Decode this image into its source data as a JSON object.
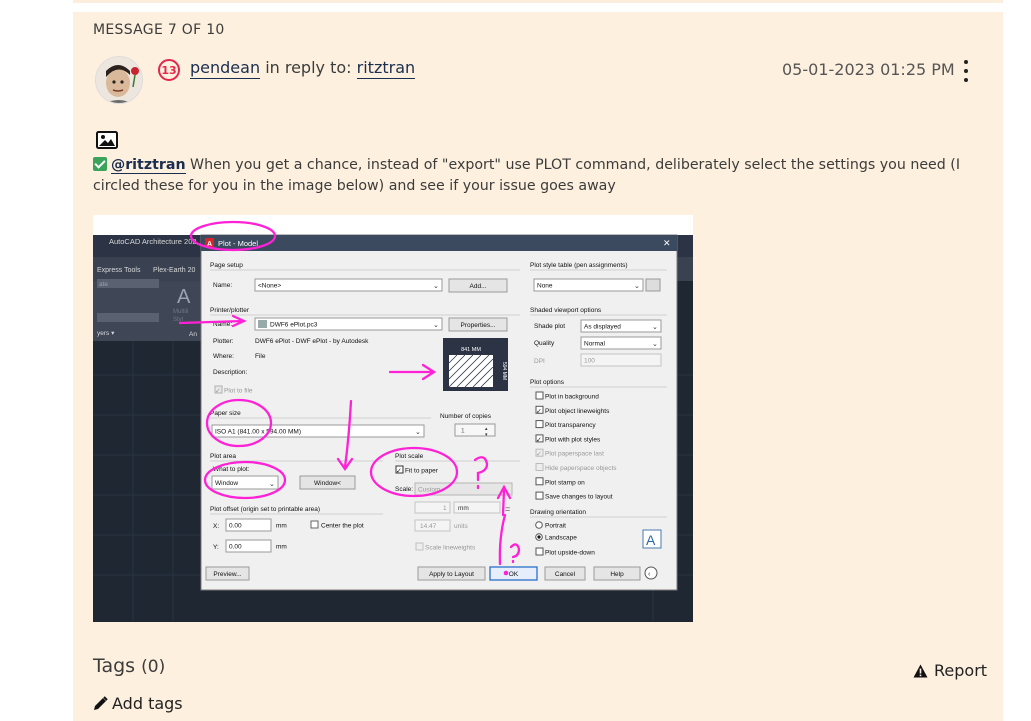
{
  "message": {
    "counter": "MESSAGE 7 OF 10",
    "rank": "13",
    "author": "pendean",
    "reply_text": "in reply to:",
    "reply_to": "ritztran",
    "date": "05-01-2023 01:25 PM",
    "mention": "@ritztran",
    "body": " When you get a chance, instead of \"export\" use PLOT command, deliberately select the settings you need (I circled these for you in the image below) and see if your issue goes away"
  },
  "dialog": {
    "app_title": "AutoCAD Architecture 202",
    "title": "Plot - Model",
    "ribbon_tab1": "Express Tools",
    "ribbon_tab2": "Plex-Earth 20",
    "ribbon_text1": "ate",
    "ribbon_text2": "yers ▾",
    "ribbon_text3": "Multili",
    "ribbon_text4": "Styl",
    "ribbon_text5": "An",
    "page_setup": {
      "label": "Page setup",
      "name_label": "Name:",
      "name_value": "<None>",
      "add_button": "Add..."
    },
    "printer": {
      "label": "Printer/plotter",
      "name_label": "Name:",
      "name_value": "DWF6 ePlot.pc3",
      "properties_button": "Properties...",
      "plotter_label": "Plotter:",
      "plotter_value": "DWF6 ePlot - DWF ePlot - by Autodesk",
      "where_label": "Where:",
      "where_value": "File",
      "description_label": "Description:",
      "plot_to_file": "Plot to file",
      "preview_width": "841 MM",
      "preview_height": "594 MM"
    },
    "paper_size": {
      "label": "Paper size",
      "value": "ISO A1 (841.00 x 594.00 MM)"
    },
    "copies": {
      "label": "Number of copies",
      "value": "1"
    },
    "plot_area": {
      "label": "Plot area",
      "what_label": "What to plot:",
      "value": "Window",
      "window_button": "Window<"
    },
    "plot_scale": {
      "label": "Plot scale",
      "fit_to_paper": "Fit to paper",
      "scale_label": "Scale:",
      "scale_value": "Custom",
      "value1": "1",
      "unit1": "mm",
      "value2": "14.47",
      "unit2": "units",
      "scale_lineweights": "Scale lineweights"
    },
    "plot_offset": {
      "label": "Plot offset (origin set to printable area)",
      "x_label": "X:",
      "x_value": "0.00",
      "y_label": "Y:",
      "y_value": "0.00",
      "unit": "mm",
      "center": "Center the plot"
    },
    "plot_style": {
      "label": "Plot style table (pen assignments)",
      "value": "None"
    },
    "shaded": {
      "label": "Shaded viewport options",
      "shade_label": "Shade plot",
      "shade_value": "As displayed",
      "quality_label": "Quality",
      "quality_value": "Normal",
      "dpi_label": "DPI",
      "dpi_value": "100"
    },
    "plot_options": {
      "label": "Plot options",
      "items": [
        {
          "label": "Plot in background",
          "checked": false,
          "disabled": false
        },
        {
          "label": "Plot object lineweights",
          "checked": true,
          "disabled": false
        },
        {
          "label": "Plot transparency",
          "checked": false,
          "disabled": false
        },
        {
          "label": "Plot with plot styles",
          "checked": true,
          "disabled": false
        },
        {
          "label": "Plot paperspace last",
          "checked": true,
          "disabled": true
        },
        {
          "label": "Hide paperspace objects",
          "checked": false,
          "disabled": true
        },
        {
          "label": "Plot stamp on",
          "checked": false,
          "disabled": false
        },
        {
          "label": "Save changes to layout",
          "checked": false,
          "disabled": false
        }
      ]
    },
    "orientation": {
      "label": "Drawing orientation",
      "portrait": "Portrait",
      "landscape": "Landscape",
      "upside_down": "Plot upside-down"
    },
    "buttons": {
      "preview": "Preview...",
      "apply": "Apply to Layout",
      "ok": "OK",
      "cancel": "Cancel",
      "help": "Help"
    }
  },
  "footer": {
    "tags_label": "Tags",
    "tags_count": "(0)",
    "report": "Report",
    "add_tags": "Add tags"
  }
}
